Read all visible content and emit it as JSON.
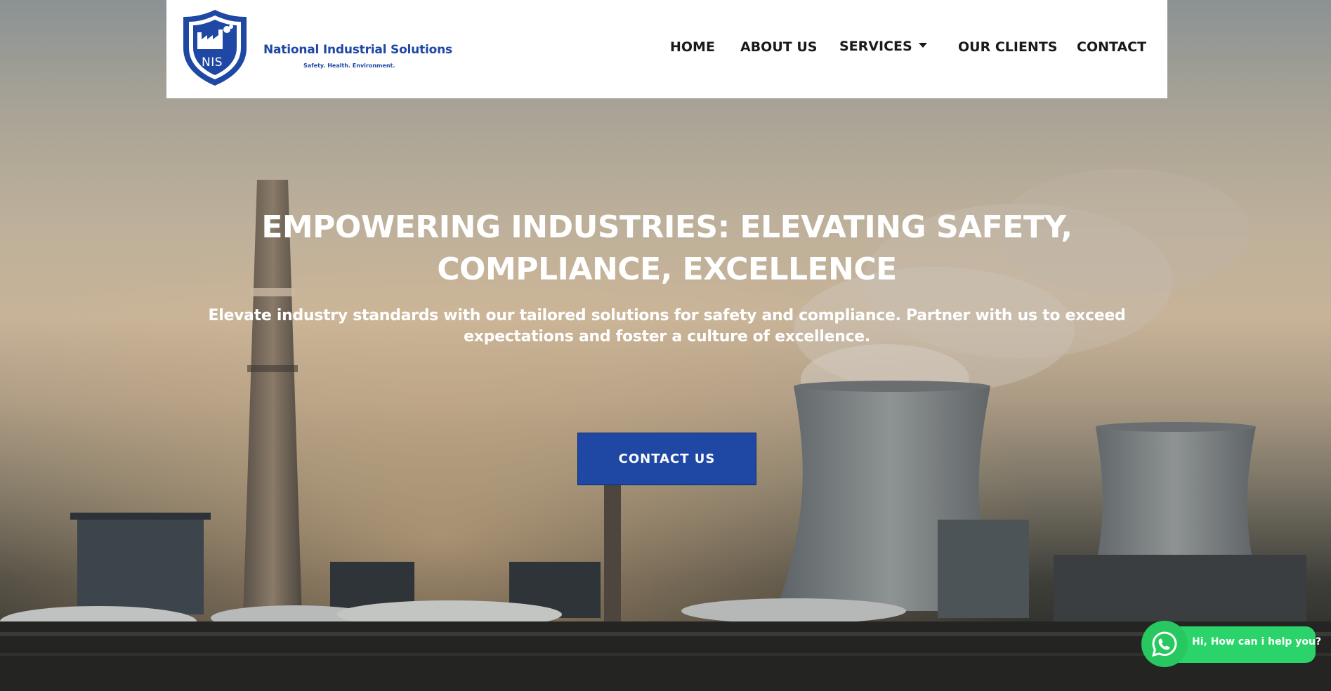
{
  "brand": {
    "logo_initials": "NIS",
    "name": "National Industrial Solutions",
    "tagline": "Safety. Health. Environment.",
    "color": "#1f47a4"
  },
  "nav": {
    "items": [
      {
        "label": "HOME"
      },
      {
        "label": "ABOUT US"
      },
      {
        "label": "SERVICES",
        "has_dropdown": true
      },
      {
        "label": "OUR CLIENTS"
      },
      {
        "label": "CONTACT"
      }
    ]
  },
  "hero": {
    "headline": "EMPOWERING INDUSTRIES: ELEVATING SAFETY, COMPLIANCE, EXCELLENCE",
    "subheadline": "Elevate industry standards with our tailored solutions for safety and compliance. Partner with us to exceed expectations and foster a culture of excellence.",
    "cta_label": "CONTACT US",
    "cta_color": "#1f47a4",
    "background": "industrial plant silhouette with chimney and cooling towers at dusk"
  },
  "whatsapp": {
    "icon": "whatsapp-icon",
    "message": "Hi, How can i help you?",
    "color": "#2bd46a"
  }
}
